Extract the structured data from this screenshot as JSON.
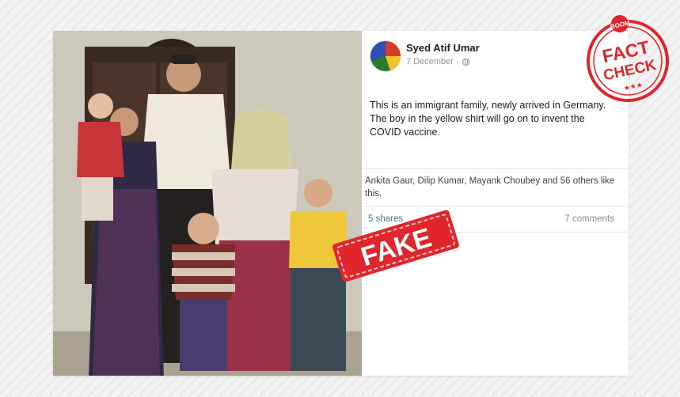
{
  "post": {
    "author": "Syed Atif Umar",
    "date": "7 December ·",
    "text": "This is an immigrant family, newly arrived in Germany. The boy in the yellow shirt will go on to invent the COVID vaccine.",
    "likes_text": "Ankita Gaur, Dilip Kumar, Mayank Choubey and 56 others like this.",
    "shares": "5 shares",
    "comments": "7 comments",
    "partially_hidden": "at"
  },
  "stamps": {
    "fake": "FAKE",
    "seal_brand": "BOOM",
    "seal_line1": "FACT",
    "seal_line2": "CHECK",
    "seal_stars": "★★★"
  },
  "colors": {
    "stamp_red": "#e0262c",
    "link_blue": "#4a6fa5"
  },
  "icons": {
    "privacy": "globe-icon"
  }
}
